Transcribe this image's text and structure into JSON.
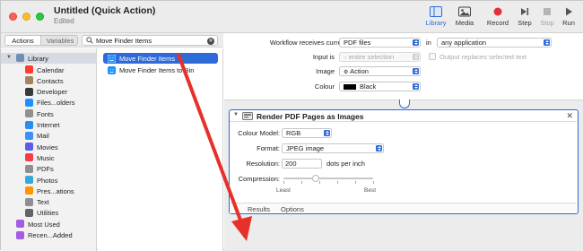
{
  "window": {
    "title": "Untitled (Quick Action)",
    "subtitle": "Edited"
  },
  "toolbar": {
    "buttons": [
      {
        "label": "Library",
        "icon": "library-icon",
        "enabled": true
      },
      {
        "label": "Media",
        "icon": "media-icon",
        "enabled": true
      },
      {
        "label": "Record",
        "icon": "record-icon",
        "enabled": true
      },
      {
        "label": "Step",
        "icon": "step-icon",
        "enabled": true
      },
      {
        "label": "Stop",
        "icon": "stop-icon",
        "enabled": false
      },
      {
        "label": "Run",
        "icon": "run-icon",
        "enabled": true
      }
    ]
  },
  "left_panel": {
    "tabs": [
      "Actions",
      "Variables"
    ],
    "active_tab": "Actions",
    "search": {
      "value": "Move Finder Items",
      "placeholder": "Name"
    }
  },
  "library": {
    "root": "Library",
    "items": [
      {
        "label": "Calendar",
        "icon": "calendar-icon",
        "color": "#ff3b30"
      },
      {
        "label": "Contacts",
        "icon": "contacts-icon",
        "color": "#a2845e"
      },
      {
        "label": "Developer",
        "icon": "developer-icon",
        "color": "#3a3a3c"
      },
      {
        "label": "Files...olders",
        "icon": "finder-icon",
        "color": "#1e90ff"
      },
      {
        "label": "Fonts",
        "icon": "fonts-icon",
        "color": "#8e8e93"
      },
      {
        "label": "Internet",
        "icon": "internet-icon",
        "color": "#2a8cf7"
      },
      {
        "label": "Mail",
        "icon": "mail-icon",
        "color": "#3d8ff5"
      },
      {
        "label": "Movies",
        "icon": "movies-icon",
        "color": "#5e5ce6"
      },
      {
        "label": "Music",
        "icon": "music-icon",
        "color": "#fc3c44"
      },
      {
        "label": "PDFs",
        "icon": "pdf-icon",
        "color": "#8e8e93"
      },
      {
        "label": "Photos",
        "icon": "photos-icon",
        "color": "#34aadc"
      },
      {
        "label": "Pres...ations",
        "icon": "presentations-icon",
        "color": "#ff9500"
      },
      {
        "label": "Text",
        "icon": "text-icon",
        "color": "#8e8e93"
      },
      {
        "label": "Utilities",
        "icon": "utilities-icon",
        "color": "#636366"
      }
    ],
    "smart_groups": [
      {
        "label": "Most Used",
        "icon": "smart-folder-icon",
        "color": "#a45de6"
      },
      {
        "label": "Recen...Added",
        "icon": "smart-folder-icon",
        "color": "#a45de6"
      }
    ]
  },
  "actions": {
    "items": [
      {
        "label": "Move Finder Items",
        "selected": true
      },
      {
        "label": "Move Finder Items to Bin",
        "selected": false
      }
    ]
  },
  "workflow_settings": {
    "receives_label": "Workflow receives current",
    "receives_value": "PDF files",
    "in_label": "in",
    "app_value": "any application",
    "input_is_label": "Input is",
    "input_is_value": "entire selection",
    "replaces_label": "Output replaces selected text",
    "image_label": "Image",
    "image_value": "Action",
    "colour_label": "Colour",
    "colour_value": "Black",
    "colour_swatch": "#000000"
  },
  "action_card": {
    "title": "Render PDF Pages as Images",
    "colour_model_label": "Colour Model:",
    "colour_model_value": "RGB",
    "format_label": "Format:",
    "format_value": "JPEG image",
    "resolution_label": "Resolution:",
    "resolution_value": "200",
    "resolution_unit": "dots per inch",
    "compression_label": "Compression:",
    "compression_level": 0.36,
    "least_label": "Least",
    "best_label": "Best",
    "footer_tabs": [
      "Results",
      "Options"
    ]
  },
  "colors": {
    "accent": "#2f6ad9",
    "annotation_arrow": "#e8302a"
  }
}
